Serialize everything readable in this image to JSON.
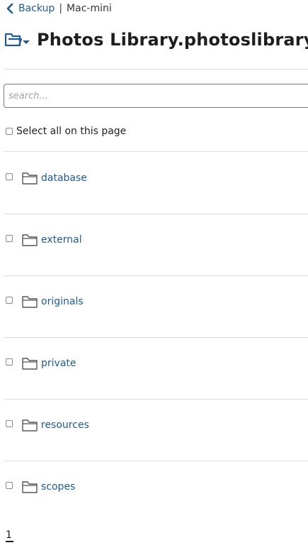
{
  "breadcrumb": {
    "back_label": "Backup",
    "separator": "|",
    "host": "Mac-mini"
  },
  "header": {
    "title": "Photos Library.photoslibrary",
    "icon": "folder-dropdown-icon"
  },
  "search": {
    "placeholder": "search...",
    "value": ""
  },
  "select_all": {
    "label": "Select all on this page",
    "checked": false
  },
  "items": [
    {
      "name": "database",
      "type": "folder",
      "checked": false
    },
    {
      "name": "external",
      "type": "folder",
      "checked": false
    },
    {
      "name": "originals",
      "type": "folder",
      "checked": false
    },
    {
      "name": "private",
      "type": "folder",
      "checked": false
    },
    {
      "name": "resources",
      "type": "folder",
      "checked": false
    },
    {
      "name": "scopes",
      "type": "folder",
      "checked": false
    }
  ],
  "pagination": {
    "current_page": "1"
  },
  "colors": {
    "link": "#1f5a96",
    "accent": "#1f5a96",
    "divider": "#dcdcdc"
  }
}
